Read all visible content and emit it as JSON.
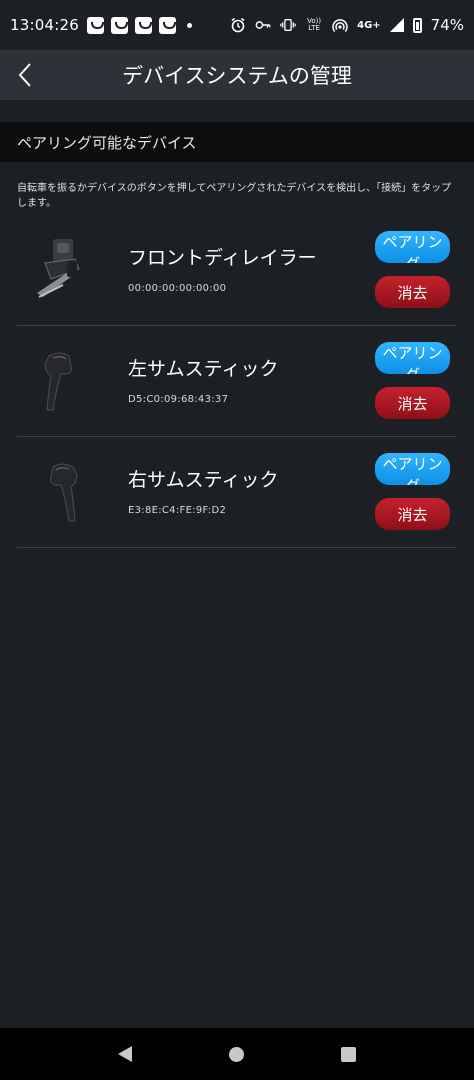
{
  "status_bar": {
    "time": "13:04:26",
    "volte_label": "Vo)) LTE",
    "network": "4G+",
    "battery": "74%",
    "icons": [
      "bag-notification-icon",
      "bag-notification-icon",
      "bag-notification-icon",
      "bag-notification-icon",
      "alarm-icon",
      "key-icon",
      "vibrate-icon",
      "hotspot-icon",
      "signal-icon",
      "battery-icon"
    ]
  },
  "app_bar": {
    "title": "デバイスシステムの管理",
    "back_icon": "chevron-left-icon"
  },
  "section": {
    "title": "ペアリング可能なデバイス",
    "instructions": "自転車を振るかデバイスのボタンを押してペアリングされたデバイスを検出し、「接続」をタップします。"
  },
  "devices": [
    {
      "name": "フロントディレイラー",
      "mac": "00:00:00:00:00:00",
      "pair_label": "ペアリング",
      "clear_label": "消去",
      "image": "front-derailleur-image"
    },
    {
      "name": "左サムスティック",
      "mac": "D5:C0:09:68:43:37",
      "pair_label": "ペアリング",
      "clear_label": "消去",
      "image": "left-shifter-image"
    },
    {
      "name": "右サムスティック",
      "mac": "E3:8E:C4:FE:9F:D2",
      "pair_label": "ペアリング",
      "clear_label": "消去",
      "image": "right-shifter-image"
    }
  ],
  "colors": {
    "background": "#1c1f23",
    "app_bar": "#2e3238",
    "section_header": "#0c0d0f",
    "pair_button": "#1aa3f5",
    "clear_button": "#b01822"
  },
  "nav": {
    "icons": [
      "back-triangle-icon",
      "home-circle-icon",
      "recents-square-icon"
    ]
  }
}
